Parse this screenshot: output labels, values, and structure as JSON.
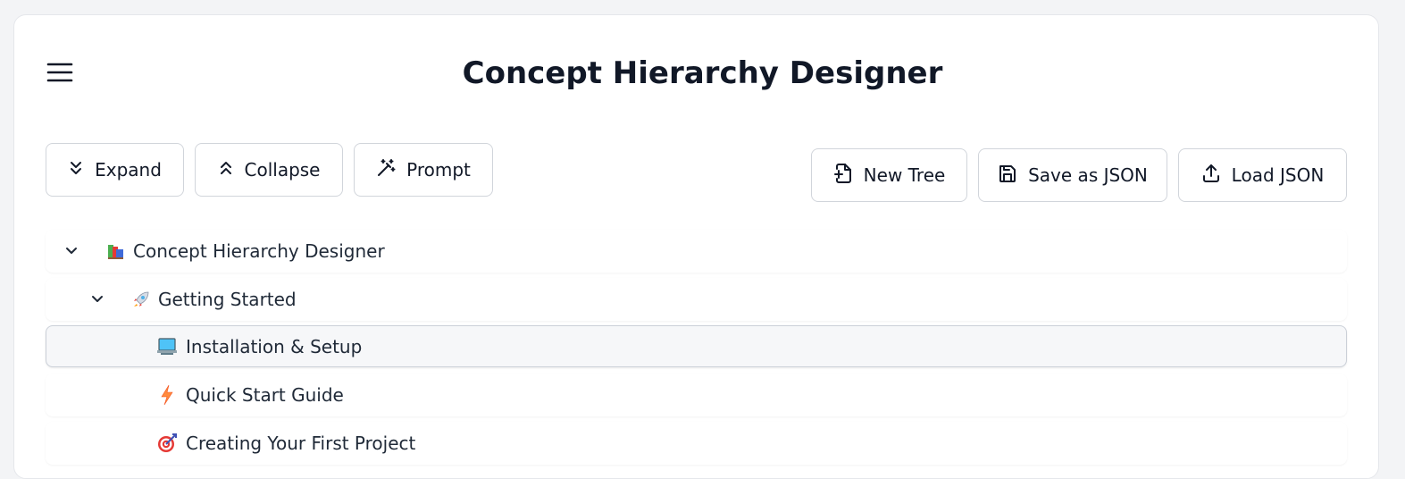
{
  "header": {
    "title": "Concept Hierarchy Designer",
    "menu_icon": "hamburger-menu-icon"
  },
  "toolbar_left": [
    {
      "label": "Expand",
      "icon": "chevrons-down-icon"
    },
    {
      "label": "Collapse",
      "icon": "chevrons-up-icon"
    },
    {
      "label": "Prompt",
      "icon": "magic-wand-icon"
    }
  ],
  "toolbar_right": [
    {
      "label": "New Tree",
      "icon": "file-plus-icon"
    },
    {
      "label": "Save as JSON",
      "icon": "save-icon"
    },
    {
      "label": "Load JSON",
      "icon": "upload-icon"
    }
  ],
  "tree": [
    {
      "label": "Concept Hierarchy Designer",
      "icon": "books-icon",
      "level": 0,
      "expanded": true,
      "selected": false
    },
    {
      "label": "Getting Started",
      "icon": "rocket-icon",
      "level": 1,
      "expanded": true,
      "selected": false
    },
    {
      "label": "Installation & Setup",
      "icon": "computer-icon",
      "level": 2,
      "expanded": false,
      "selected": true
    },
    {
      "label": "Quick Start Guide",
      "icon": "lightning-icon",
      "level": 2,
      "expanded": false,
      "selected": false
    },
    {
      "label": "Creating Your First Project",
      "icon": "target-icon",
      "level": 2,
      "expanded": false,
      "selected": false
    }
  ],
  "colors": {
    "accent_border": "#d1d5db",
    "selected_bg": "#f6f7f9",
    "text": "#111827"
  }
}
